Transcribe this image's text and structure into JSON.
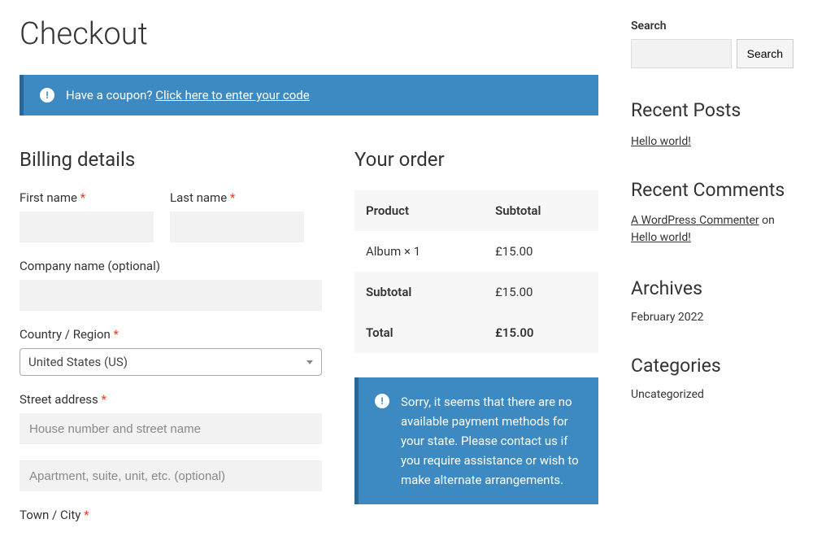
{
  "page_title": "Checkout",
  "coupon": {
    "prompt": "Have a coupon? ",
    "link_text": "Click here to enter your code"
  },
  "billing": {
    "heading": "Billing details",
    "first_name": {
      "label": "First name ",
      "value": ""
    },
    "last_name": {
      "label": "Last name ",
      "value": ""
    },
    "company": {
      "label": "Company name (optional)",
      "value": ""
    },
    "country": {
      "label": "Country / Region ",
      "selected": "United States (US)"
    },
    "street": {
      "label": "Street address ",
      "placeholder1": "House number and street name",
      "placeholder2": "Apartment, suite, unit, etc. (optional)"
    },
    "town": {
      "label": "Town / City "
    }
  },
  "order": {
    "heading": "Your order",
    "headers": {
      "product": "Product",
      "subtotal": "Subtotal"
    },
    "items": [
      {
        "name": "Album  ",
        "qty": "× 1",
        "price": "£15.00"
      }
    ],
    "subtotal": {
      "label": "Subtotal",
      "value": "£15.00"
    },
    "total": {
      "label": "Total",
      "value": "£15.00"
    },
    "payment_notice": "Sorry, it seems that there are no available payment methods for your state. Please contact us if you require assistance or wish to make alternate arrangements."
  },
  "sidebar": {
    "search": {
      "label": "Search",
      "button": "Search"
    },
    "recent_posts": {
      "heading": "Recent Posts",
      "items": [
        "Hello world!"
      ]
    },
    "recent_comments": {
      "heading": "Recent Comments",
      "commenter": "A WordPress Commenter",
      "on": " on ",
      "post": "Hello world!"
    },
    "archives": {
      "heading": "Archives",
      "items": [
        "February 2022"
      ]
    },
    "categories": {
      "heading": "Categories",
      "items": [
        "Uncategorized"
      ]
    }
  },
  "asterisk": "*"
}
